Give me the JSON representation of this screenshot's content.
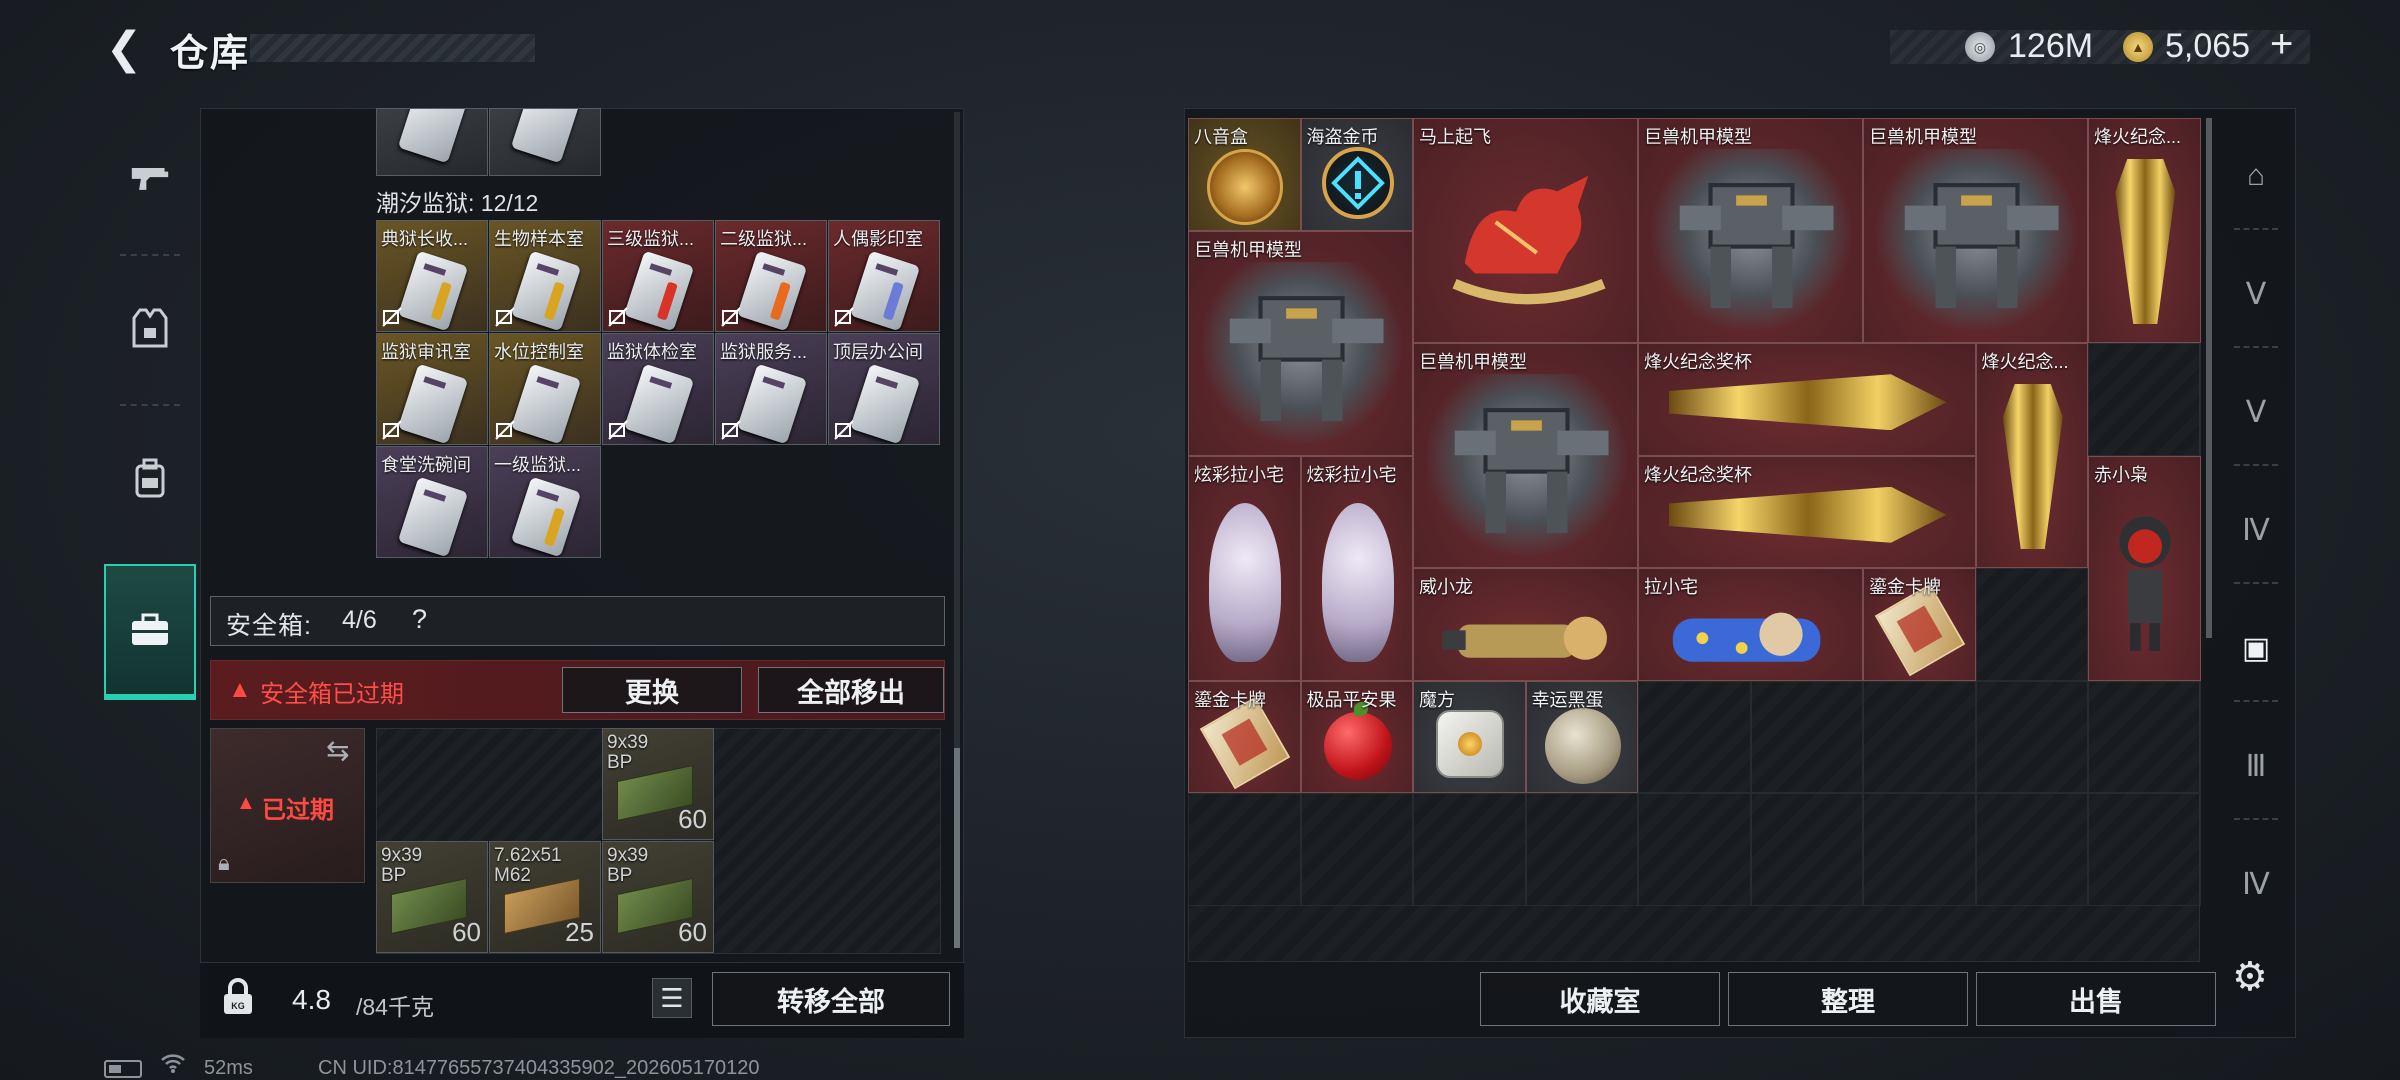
{
  "header": {
    "back_icon": "back-arrow-icon",
    "title": "仓库",
    "currency1_icon": "silver-coin-icon",
    "currency1_value": "126M",
    "currency2_icon": "gold-coin-icon",
    "currency2_value": "5,065",
    "currency2_plus": "+"
  },
  "left_tabs": [
    {
      "name": "weapons",
      "icon": "gun-icon"
    },
    {
      "name": "armor",
      "icon": "vest-icon"
    },
    {
      "name": "backpack",
      "icon": "backpack-icon"
    },
    {
      "name": "case",
      "icon": "toolbox-icon",
      "selected": true
    }
  ],
  "keycards": {
    "section_title": "潮汐监狱: 12/12",
    "items": [
      {
        "label": "典狱长收...",
        "bg": "gold",
        "stripe": "gold"
      },
      {
        "label": "生物样本室",
        "bg": "gold",
        "stripe": "gold"
      },
      {
        "label": "三级监狱...",
        "bg": "red",
        "stripe": "red"
      },
      {
        "label": "二级监狱...",
        "bg": "red",
        "stripe": "orange"
      },
      {
        "label": "人偶影印室",
        "bg": "red",
        "stripe": "blue"
      },
      {
        "label": "监狱审讯室",
        "bg": "gold",
        "stripe": "none"
      },
      {
        "label": "水位控制室",
        "bg": "gold",
        "stripe": "none"
      },
      {
        "label": "监狱体检室",
        "bg": "purple",
        "stripe": "none"
      },
      {
        "label": "监狱服务...",
        "bg": "purple",
        "stripe": "none"
      },
      {
        "label": "顶层办公间",
        "bg": "purple",
        "stripe": "none"
      },
      {
        "label": "食堂洗碗间",
        "bg": "purple",
        "stripe": "none"
      },
      {
        "label": "一级监狱...",
        "bg": "purple",
        "stripe": "gold"
      }
    ]
  },
  "safe_box": {
    "title": "安全箱:",
    "value": "4/6",
    "help": "?",
    "warning": "安全箱已过期",
    "replace_label": "更换",
    "move_out_label": "全部移出",
    "expired_label": "已过期",
    "ammo": [
      {
        "name": "9x39\nBP",
        "count": "60",
        "color": "green"
      },
      {
        "name": "9x39\nBP",
        "count": "60",
        "color": "green"
      },
      {
        "name": "7.62x51\nM62",
        "count": "25",
        "color": "tan"
      },
      {
        "name": "9x39\nBP",
        "count": "60",
        "color": "green"
      }
    ]
  },
  "footer_left": {
    "weight_value": "4.8",
    "weight_max": "/84千克",
    "transfer_all_label": "转移全部"
  },
  "stash_items": [
    {
      "label": "八音盒",
      "style": "gold",
      "pic": "music-box"
    },
    {
      "label": "海盗金币",
      "style": "dark",
      "pic": "pirate-coin"
    },
    {
      "label": "马上起飞",
      "style": "red",
      "pic": "red-horse"
    },
    {
      "label": "巨兽机甲模型",
      "style": "red",
      "pic": "mech"
    },
    {
      "label": "巨兽机甲模型",
      "style": "red",
      "pic": "mech"
    },
    {
      "label": "烽火纪念...",
      "style": "red",
      "pic": "trophy-v"
    },
    {
      "label": "巨兽机甲模型",
      "style": "red",
      "pic": "mech"
    },
    {
      "label": "巨兽机甲模型",
      "style": "red",
      "pic": "mech"
    },
    {
      "label": "烽火纪念奖杯",
      "style": "red",
      "pic": "trophy-h"
    },
    {
      "label": "烽火纪念...",
      "style": "red",
      "pic": "trophy-v"
    },
    {
      "label": "炫彩拉小宅",
      "style": "red",
      "pic": "doll"
    },
    {
      "label": "炫彩拉小宅",
      "style": "red",
      "pic": "doll"
    },
    {
      "label": "烽火纪念奖杯",
      "style": "red",
      "pic": "trophy-h"
    },
    {
      "label": "赤小枭",
      "style": "red",
      "pic": "red-figure"
    },
    {
      "label": "威小龙",
      "style": "red",
      "pic": "lying-figure"
    },
    {
      "label": "拉小宅",
      "style": "red",
      "pic": "lying-figure-blue"
    },
    {
      "label": "鎏金卡牌",
      "style": "red",
      "pic": "card"
    },
    {
      "label": "鎏金卡牌",
      "style": "red",
      "pic": "card"
    },
    {
      "label": "极品平安果",
      "style": "red",
      "pic": "apple"
    },
    {
      "label": "魔方",
      "style": "dark",
      "pic": "cube"
    },
    {
      "label": "幸运黑蛋",
      "style": "dark",
      "pic": "egg"
    }
  ],
  "right_tabs": [
    {
      "icon": "safehouse-icon"
    },
    {
      "icon": "storage-v-icon"
    },
    {
      "icon": "storage-v2-icon"
    },
    {
      "icon": "storage-iv-icon"
    },
    {
      "icon": "storage-selected-icon",
      "selected": true
    },
    {
      "icon": "storage-iii-icon"
    },
    {
      "icon": "storage-iv2-icon"
    }
  ],
  "footer_right": {
    "collection_label": "收藏室",
    "organize_label": "整理",
    "sell_label": "出售",
    "settings_icon": "gear-icon"
  },
  "status_bar": {
    "ping": "52ms",
    "uid": "CN UID:8147765573740433590​2_202605170120"
  }
}
